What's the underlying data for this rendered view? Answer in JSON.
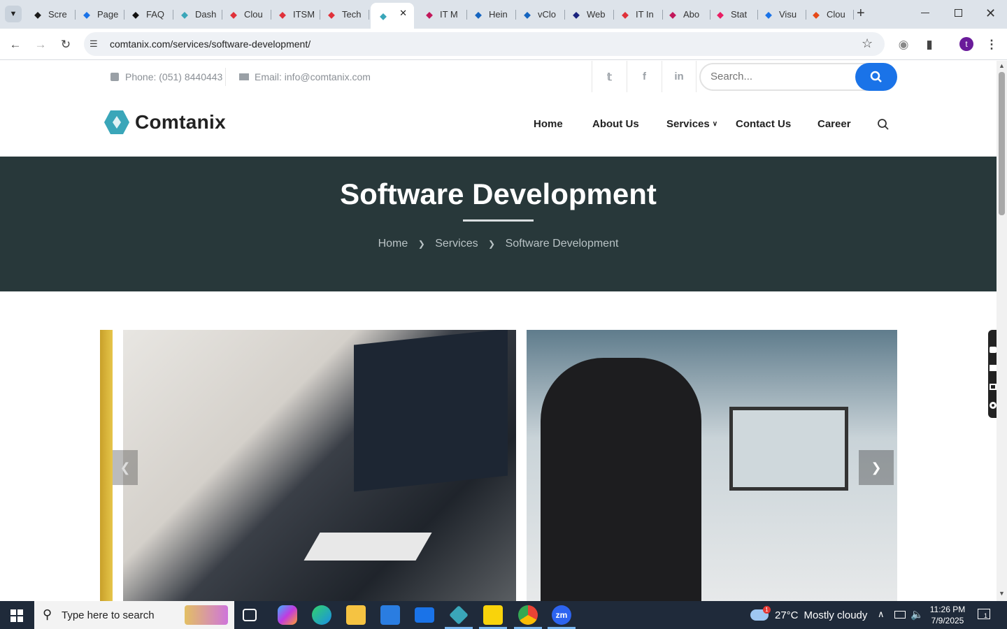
{
  "browser": {
    "tabs": [
      {
        "label": "Scre",
        "icon": "screencast-icon",
        "color": "#1b1b1b"
      },
      {
        "label": "Page",
        "icon": "speed-icon",
        "color": "#1a73e8"
      },
      {
        "label": "FAQ",
        "icon": "openai-icon",
        "color": "#111111"
      },
      {
        "label": "Dash",
        "icon": "comtanix-icon",
        "color": "#3aa6b9"
      },
      {
        "label": "Clou",
        "icon": "diamond-icon",
        "color": "#e0313a"
      },
      {
        "label": "ITSM",
        "icon": "diamond-icon",
        "color": "#e0313a"
      },
      {
        "label": "Tech",
        "icon": "diamond-icon",
        "color": "#e0313a"
      },
      {
        "label": "",
        "icon": "comtanix-icon",
        "color": "#3aa6b9"
      },
      {
        "label": "IT M",
        "icon": "v-icon",
        "color": "#c2185b"
      },
      {
        "label": "Hein",
        "icon": "scales-icon",
        "color": "#1565c0"
      },
      {
        "label": "vClo",
        "icon": "check-icon",
        "color": "#1565c0"
      },
      {
        "label": "Web",
        "icon": "x-icon",
        "color": "#1a237e"
      },
      {
        "label": "IT In",
        "icon": "diamond-icon",
        "color": "#e0313a"
      },
      {
        "label": "Abo",
        "icon": "swirl-icon",
        "color": "#c2185b"
      },
      {
        "label": "Stat",
        "icon": "pen-icon",
        "color": "#e91e63"
      },
      {
        "label": "Visu",
        "icon": "pulse-icon",
        "color": "#1a73e8"
      },
      {
        "label": "Clou",
        "icon": "pencil-icon",
        "color": "#e64a19"
      }
    ],
    "url": "comtanix.com/services/software-development/",
    "profile_initial": "t",
    "profile_color": "#6a1b9a"
  },
  "topbar": {
    "phone": "Phone: (051) 8440443",
    "email": "Email: info@comtanix.com",
    "search_placeholder": "Search..."
  },
  "header": {
    "logo_text": "Comtanix",
    "logo_color": "#3aa6b9",
    "nav": [
      "Home",
      "About Us",
      "Services",
      "Contact Us",
      "Career"
    ]
  },
  "hero": {
    "title": "Software Development",
    "breadcrumb": [
      "Home",
      "Services",
      "Software Development"
    ],
    "bg": "#28383a"
  },
  "taskbar": {
    "search_placeholder": "Type here to search",
    "weather_temp": "27°C",
    "weather_text": "Mostly cloudy",
    "weather_badge": "1",
    "time": "11:26 PM",
    "date": "7/9/2025",
    "notification_count": "1"
  }
}
